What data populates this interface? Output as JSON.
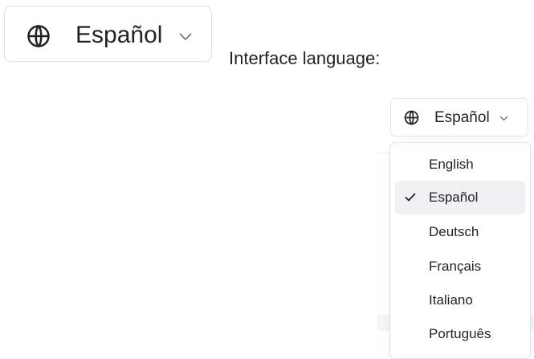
{
  "language_button_large": {
    "icon": "globe-icon",
    "label": "Español",
    "chevron": "chevron-down-icon"
  },
  "caption": "Interface language:",
  "language_button": {
    "icon": "globe-icon",
    "label": "Español",
    "chevron": "chevron-down-icon"
  },
  "menu": {
    "items": [
      {
        "label": "English",
        "selected": false
      },
      {
        "label": "Español",
        "selected": true
      },
      {
        "label": "Deutsch",
        "selected": false
      },
      {
        "label": "Français",
        "selected": false
      },
      {
        "label": "Italiano",
        "selected": false
      },
      {
        "label": "Português",
        "selected": false
      }
    ],
    "check_icon": "check-icon"
  },
  "colors": {
    "text": "#1f2328",
    "border": "#dfe3e8",
    "selected_bg": "#eff1f5"
  }
}
